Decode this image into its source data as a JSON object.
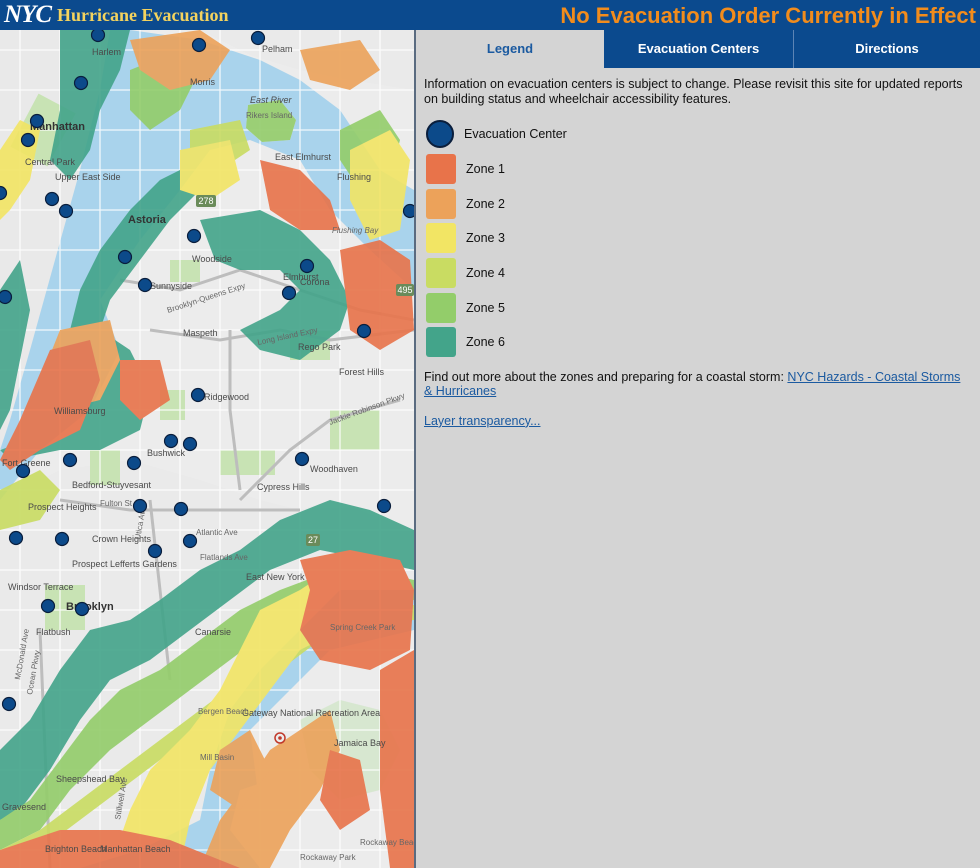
{
  "header": {
    "logo_text": "NYC",
    "app_title": "Hurricane Evacuation",
    "banner": "No Evacuation Order Currently in Effect"
  },
  "tabs": [
    {
      "label": "Legend",
      "active": true
    },
    {
      "label": "Evacuation Centers",
      "active": false
    },
    {
      "label": "Directions",
      "active": false
    }
  ],
  "legend": {
    "info": "Information on evacuation centers is subject to change. Please revisit this site for updated reports on building status and wheelchair accessibility features.",
    "items": [
      {
        "label": "Evacuation Center",
        "symbol": "circle",
        "color": "#0c4a8a"
      },
      {
        "label": "Zone 1",
        "symbol": "square",
        "color": "#e8734a"
      },
      {
        "label": "Zone 2",
        "symbol": "square",
        "color": "#eca25a"
      },
      {
        "label": "Zone 3",
        "symbol": "square",
        "color": "#f2e564"
      },
      {
        "label": "Zone 4",
        "symbol": "square",
        "color": "#c9dc62"
      },
      {
        "label": "Zone 5",
        "symbol": "square",
        "color": "#93cd6a"
      },
      {
        "label": "Zone 6",
        "symbol": "square",
        "color": "#43a48a"
      }
    ],
    "more_text": "Find out more about the zones and preparing for a coastal storm:",
    "more_link": "NYC Hazards - Coastal Storms & Hurricanes",
    "transparency_link": "Layer transparency..."
  },
  "map": {
    "water_color": "#a9d3ec",
    "land_color": "#ececec",
    "labels": [
      "Harlem",
      "Morris",
      "East River",
      "Rikers Island",
      "Pelham",
      "Astoria",
      "Manhattan",
      "Central Park",
      "Upper East Side",
      "East Elmhurst",
      "Flushing",
      "Flushing Bay",
      "Woodside",
      "Sunnyside",
      "Elmhurst",
      "Corona",
      "Maspeth",
      "Rego Park",
      "Forest Hills",
      "Ridgewood",
      "Bushwick",
      "Woodhaven",
      "Fort Greene",
      "Bedford-Stuyvesant",
      "Cypress Hills",
      "Prospect Heights",
      "Crown Heights",
      "Prospect Lefferts Gardens",
      "Windsor Terrace",
      "Brooklyn",
      "Flatbush",
      "Canarsie",
      "East New York",
      "Spring Creek Park",
      "Gateway National Recreation Area",
      "Jamaica Bay",
      "Mill Basin",
      "Bergen Beach",
      "Sheepshead Bay",
      "Gravesend",
      "Brighton Beach",
      "Manhattan Beach",
      "Rockaway Park",
      "Rockaway Beach",
      "Williamsburg",
      "Brooklyn-Queens Expy",
      "Long Island Expy",
      "Jackie Robinson Pkwy",
      "Fulton St",
      "Atlantic Ave",
      "Ocean Pkwy",
      "McDonald Ave",
      "Utica Ave",
      "Flatlands Ave",
      "Stillwell Ave"
    ],
    "route_shields": [
      "278",
      "495",
      "27"
    ]
  }
}
